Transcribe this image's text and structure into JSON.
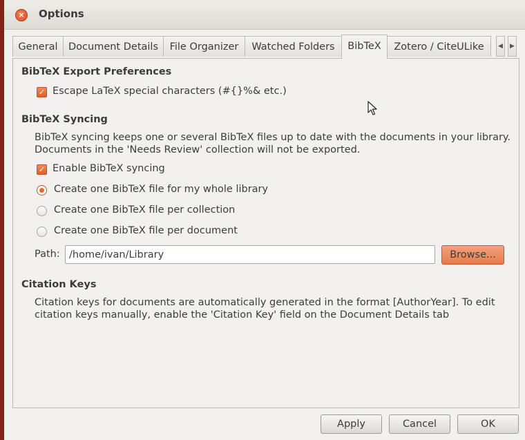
{
  "window": {
    "title": "Options",
    "close_glyph": "×"
  },
  "tabs": [
    {
      "label": "General",
      "active": false
    },
    {
      "label": "Document Details",
      "active": false
    },
    {
      "label": "File Organizer",
      "active": false
    },
    {
      "label": "Watched Folders",
      "active": false
    },
    {
      "label": "BibTeX",
      "active": true
    },
    {
      "label": "Zotero / CiteULike",
      "active": false
    }
  ],
  "tab_scroll": {
    "left": "◀",
    "right": "▶"
  },
  "export": {
    "heading": "BibTeX Export Preferences",
    "escape_label": "Escape LaTeX special characters (#{}%& etc.)",
    "escape_checked": true
  },
  "syncing": {
    "heading": "BibTeX Syncing",
    "description_line1": "BibTeX syncing keeps one or several BibTeX files up to date with the documents in your library.",
    "description_line2": "Documents in the 'Needs Review' collection will not be exported.",
    "enable_label": "Enable BibTeX syncing",
    "enable_checked": true,
    "options": [
      {
        "label": "Create one BibTeX file for my whole library",
        "selected": true
      },
      {
        "label": "Create one BibTeX file per collection",
        "selected": false
      },
      {
        "label": "Create one BibTeX file per document",
        "selected": false
      }
    ],
    "path_label": "Path:",
    "path_value": "/home/ivan/Library",
    "browse_label": "Browse..."
  },
  "citation": {
    "heading": "Citation Keys",
    "description_line1": "Citation keys for documents are automatically generated in the format [AuthorYear].  To edit",
    "description_line2": "citation keys manually, enable the 'Citation Key' field on the Document Details tab"
  },
  "buttons": {
    "apply": "Apply",
    "cancel": "Cancel",
    "ok": "OK"
  },
  "colors": {
    "accent": "#e06a36",
    "window_bg": "#f2f1f0"
  }
}
